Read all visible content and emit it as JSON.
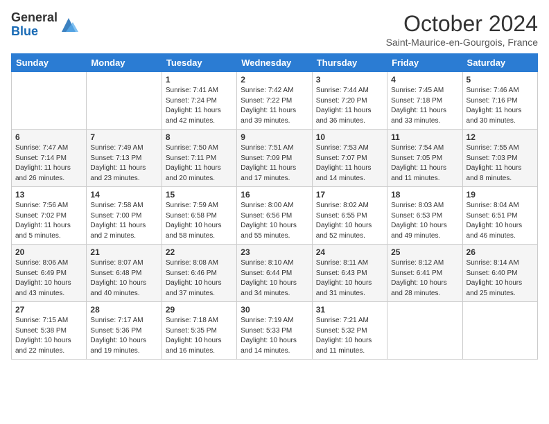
{
  "header": {
    "logo_general": "General",
    "logo_blue": "Blue",
    "title": "October 2024",
    "location": "Saint-Maurice-en-Gourgois, France"
  },
  "days_of_week": [
    "Sunday",
    "Monday",
    "Tuesday",
    "Wednesday",
    "Thursday",
    "Friday",
    "Saturday"
  ],
  "weeks": [
    [
      {
        "day": "",
        "content": ""
      },
      {
        "day": "",
        "content": ""
      },
      {
        "day": "1",
        "content": "Sunrise: 7:41 AM\nSunset: 7:24 PM\nDaylight: 11 hours and 42 minutes."
      },
      {
        "day": "2",
        "content": "Sunrise: 7:42 AM\nSunset: 7:22 PM\nDaylight: 11 hours and 39 minutes."
      },
      {
        "day": "3",
        "content": "Sunrise: 7:44 AM\nSunset: 7:20 PM\nDaylight: 11 hours and 36 minutes."
      },
      {
        "day": "4",
        "content": "Sunrise: 7:45 AM\nSunset: 7:18 PM\nDaylight: 11 hours and 33 minutes."
      },
      {
        "day": "5",
        "content": "Sunrise: 7:46 AM\nSunset: 7:16 PM\nDaylight: 11 hours and 30 minutes."
      }
    ],
    [
      {
        "day": "6",
        "content": "Sunrise: 7:47 AM\nSunset: 7:14 PM\nDaylight: 11 hours and 26 minutes."
      },
      {
        "day": "7",
        "content": "Sunrise: 7:49 AM\nSunset: 7:13 PM\nDaylight: 11 hours and 23 minutes."
      },
      {
        "day": "8",
        "content": "Sunrise: 7:50 AM\nSunset: 7:11 PM\nDaylight: 11 hours and 20 minutes."
      },
      {
        "day": "9",
        "content": "Sunrise: 7:51 AM\nSunset: 7:09 PM\nDaylight: 11 hours and 17 minutes."
      },
      {
        "day": "10",
        "content": "Sunrise: 7:53 AM\nSunset: 7:07 PM\nDaylight: 11 hours and 14 minutes."
      },
      {
        "day": "11",
        "content": "Sunrise: 7:54 AM\nSunset: 7:05 PM\nDaylight: 11 hours and 11 minutes."
      },
      {
        "day": "12",
        "content": "Sunrise: 7:55 AM\nSunset: 7:03 PM\nDaylight: 11 hours and 8 minutes."
      }
    ],
    [
      {
        "day": "13",
        "content": "Sunrise: 7:56 AM\nSunset: 7:02 PM\nDaylight: 11 hours and 5 minutes."
      },
      {
        "day": "14",
        "content": "Sunrise: 7:58 AM\nSunset: 7:00 PM\nDaylight: 11 hours and 2 minutes."
      },
      {
        "day": "15",
        "content": "Sunrise: 7:59 AM\nSunset: 6:58 PM\nDaylight: 10 hours and 58 minutes."
      },
      {
        "day": "16",
        "content": "Sunrise: 8:00 AM\nSunset: 6:56 PM\nDaylight: 10 hours and 55 minutes."
      },
      {
        "day": "17",
        "content": "Sunrise: 8:02 AM\nSunset: 6:55 PM\nDaylight: 10 hours and 52 minutes."
      },
      {
        "day": "18",
        "content": "Sunrise: 8:03 AM\nSunset: 6:53 PM\nDaylight: 10 hours and 49 minutes."
      },
      {
        "day": "19",
        "content": "Sunrise: 8:04 AM\nSunset: 6:51 PM\nDaylight: 10 hours and 46 minutes."
      }
    ],
    [
      {
        "day": "20",
        "content": "Sunrise: 8:06 AM\nSunset: 6:49 PM\nDaylight: 10 hours and 43 minutes."
      },
      {
        "day": "21",
        "content": "Sunrise: 8:07 AM\nSunset: 6:48 PM\nDaylight: 10 hours and 40 minutes."
      },
      {
        "day": "22",
        "content": "Sunrise: 8:08 AM\nSunset: 6:46 PM\nDaylight: 10 hours and 37 minutes."
      },
      {
        "day": "23",
        "content": "Sunrise: 8:10 AM\nSunset: 6:44 PM\nDaylight: 10 hours and 34 minutes."
      },
      {
        "day": "24",
        "content": "Sunrise: 8:11 AM\nSunset: 6:43 PM\nDaylight: 10 hours and 31 minutes."
      },
      {
        "day": "25",
        "content": "Sunrise: 8:12 AM\nSunset: 6:41 PM\nDaylight: 10 hours and 28 minutes."
      },
      {
        "day": "26",
        "content": "Sunrise: 8:14 AM\nSunset: 6:40 PM\nDaylight: 10 hours and 25 minutes."
      }
    ],
    [
      {
        "day": "27",
        "content": "Sunrise: 7:15 AM\nSunset: 5:38 PM\nDaylight: 10 hours and 22 minutes."
      },
      {
        "day": "28",
        "content": "Sunrise: 7:17 AM\nSunset: 5:36 PM\nDaylight: 10 hours and 19 minutes."
      },
      {
        "day": "29",
        "content": "Sunrise: 7:18 AM\nSunset: 5:35 PM\nDaylight: 10 hours and 16 minutes."
      },
      {
        "day": "30",
        "content": "Sunrise: 7:19 AM\nSunset: 5:33 PM\nDaylight: 10 hours and 14 minutes."
      },
      {
        "day": "31",
        "content": "Sunrise: 7:21 AM\nSunset: 5:32 PM\nDaylight: 10 hours and 11 minutes."
      },
      {
        "day": "",
        "content": ""
      },
      {
        "day": "",
        "content": ""
      }
    ]
  ]
}
